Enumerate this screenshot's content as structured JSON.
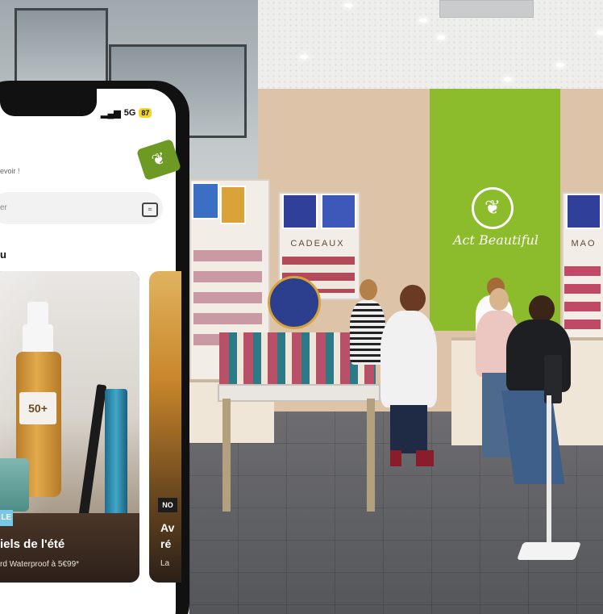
{
  "phone": {
    "status": {
      "signal": "5G",
      "battery": "87"
    },
    "greeting": "evoir !",
    "search": {
      "placeholder": "er"
    },
    "section_title": "u",
    "cards": [
      {
        "tag": "LE",
        "title": "iels de l'été",
        "subtitle": "rd Waterproof à 5€99*",
        "product_label": "50+"
      },
      {
        "tag": "NO",
        "title": "Av ré",
        "subtitle": "La"
      }
    ],
    "bottom_text": ""
  },
  "store": {
    "sign_left": "CADEAUX",
    "sign_right": "MAO",
    "brand_script": "Act Beautiful"
  },
  "colors": {
    "brand_green": "#8cbb2c",
    "badge_green": "#6e9a24",
    "battery_yellow": "#f5d61d"
  },
  "icons": [
    "signal-icon",
    "brand-leaf-icon",
    "scan-icon"
  ]
}
